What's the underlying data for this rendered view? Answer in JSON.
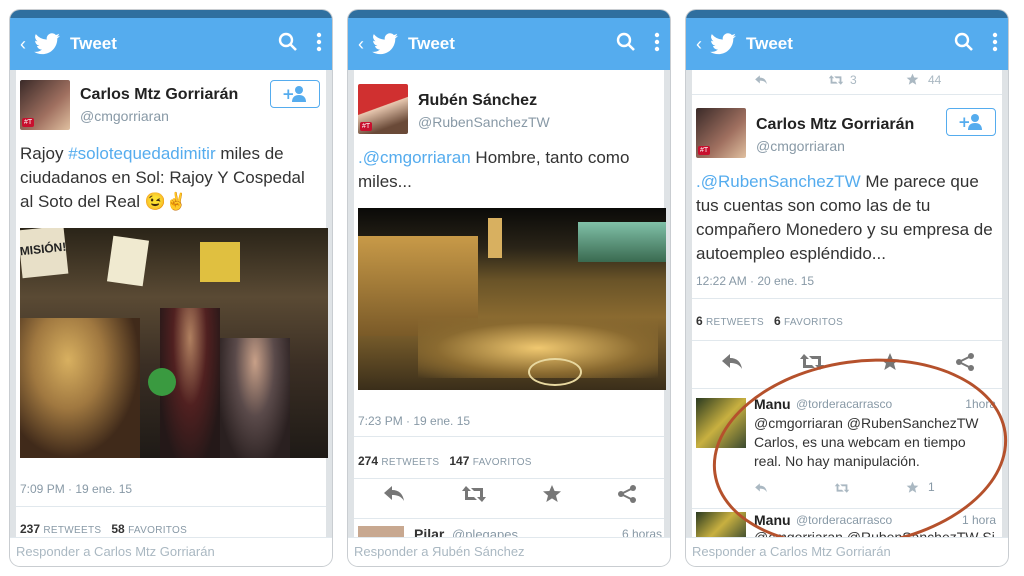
{
  "phones": [
    {
      "appbar_title": "Tweet",
      "name": "Carlos Mtz Gorriarán",
      "handle": "@cmgorriaran",
      "text_pre": "Rajoy ",
      "text_link": "#solotequedadimitir",
      "text_post": " miles de ciudadanos en Sol: Rajoy Y Cospedal al Soto del Real 😉✌",
      "photo_sign": "MISIÓN!",
      "time": "7:09 PM · 19 ene. 15",
      "retweets": "237",
      "retweets_label": "RETWEETS",
      "favorites": "58",
      "favorites_label": "FAVORITOS",
      "reply_placeholder": "Responder a Carlos Mtz Gorriarán"
    },
    {
      "appbar_title": "Tweet",
      "name": "Яubén Sánchez",
      "handle": "@RubenSanchezTW",
      "text_link": ".@cmgorriaran",
      "text_post": " Hombre, tanto como miles...",
      "time": "7:23 PM · 19 ene. 15",
      "retweets": "274",
      "retweets_label": "RETWEETS",
      "favorites": "147",
      "favorites_label": "FAVORITOS",
      "next_name": "Pilar",
      "next_handle": "@plegapes",
      "next_time": "6 horas",
      "reply_placeholder": "Responder a Яubén Sánchez"
    },
    {
      "appbar_title": "Tweet",
      "top_retweets": "3",
      "top_favorites": "44",
      "name": "Carlos Mtz Gorriarán",
      "handle": "@cmgorriaran",
      "text_link": ".@RubenSanchezTW",
      "text_post": " Me parece que tus cuentas son como las de tu compañero Monedero y su empresa de autoempleo espléndido...",
      "time": "12:22 AM · 20 ene. 15",
      "retweets": "6",
      "retweets_label": "RETWEETS",
      "favorites": "6",
      "favorites_label": "FAVORITOS",
      "reply1_name": "Manu",
      "reply1_handle": "@torderacarrasco",
      "reply1_time": "1hora",
      "reply1_text": "@cmgorriaran @RubenSanchezTW Carlos, es una webcam en tiempo real. No hay manipulación.",
      "reply1_favs": "1",
      "reply2_name": "Manu",
      "reply2_handle": "@torderacarrasco",
      "reply2_time": "1 hora",
      "reply2_text": "@cmgorriaran @RubenSanchezTW Si",
      "reply_placeholder": "Responder a Carlos Mtz Gorriarán"
    }
  ],
  "colors": {
    "twitter_blue": "#55acee",
    "annotation": "#b5512c"
  },
  "icons": [
    "back-icon",
    "twitter-bird-icon",
    "search-icon",
    "more-icon",
    "follow-icon",
    "reply-icon",
    "retweet-icon",
    "favorite-icon",
    "share-icon"
  ]
}
